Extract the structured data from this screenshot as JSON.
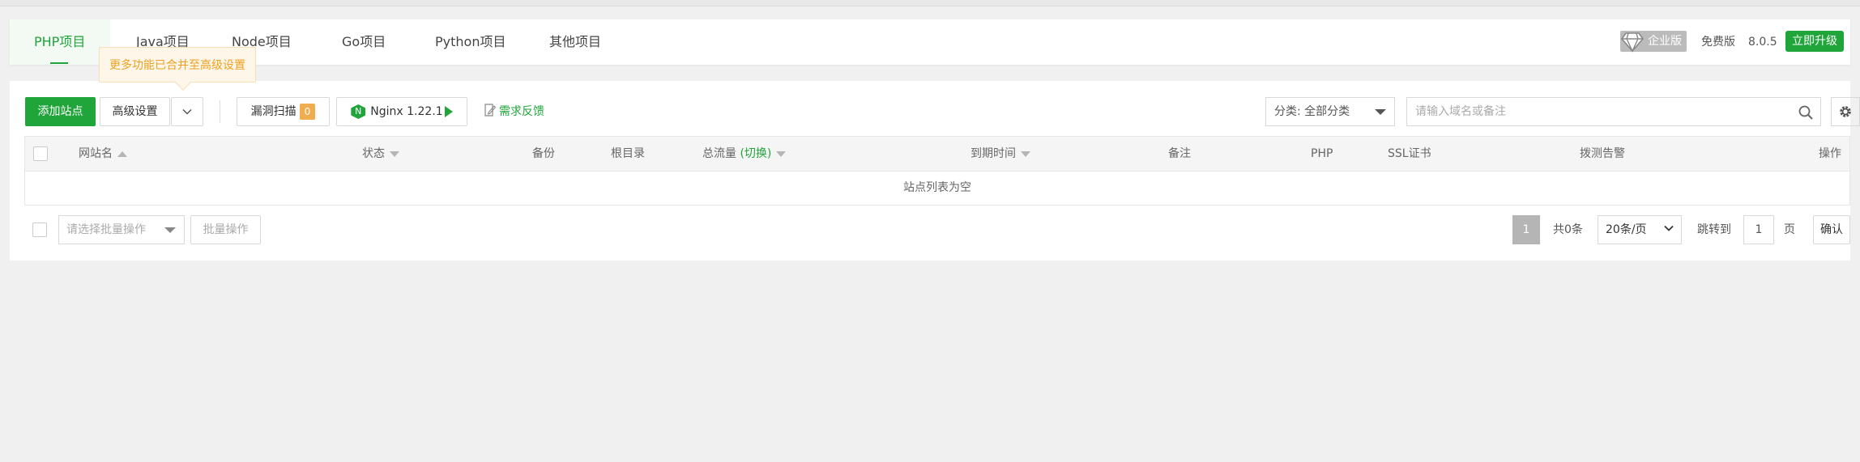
{
  "tabs": [
    {
      "label": "PHP项目",
      "active": true
    },
    {
      "label": "Java项目",
      "active": false
    },
    {
      "label": "Node项目",
      "active": false
    },
    {
      "label": "Go项目",
      "active": false
    },
    {
      "label": "Python项目",
      "active": false
    },
    {
      "label": "其他项目",
      "active": false
    }
  ],
  "header_right": {
    "edition": "企业版",
    "plan": "免费版",
    "version": "8.0.5",
    "upgrade": "立即升级"
  },
  "tooltip": "更多功能已合并至高级设置",
  "toolbar": {
    "add_site": "添加站点",
    "advanced": "高级设置",
    "vuln_scan": "漏洞扫描",
    "vuln_count": "0",
    "nginx": "Nginx 1.22.1",
    "feedback": "需求反馈",
    "category": "分类: 全部分类",
    "search_placeholder": "请输入域名或备注"
  },
  "table": {
    "columns": [
      "网站名",
      "状态",
      "备份",
      "根目录",
      "总流量",
      "(切换)",
      "到期时间",
      "备注",
      "PHP",
      "SSL证书",
      "拨测告警",
      "操作"
    ],
    "empty_text": "站点列表为空"
  },
  "footer": {
    "batch_placeholder": "请选择批量操作",
    "batch_button": "批量操作",
    "current_page": "1",
    "total": "共0条",
    "page_size": "20条/页",
    "jump_label": "跳转到",
    "jump_value": "1",
    "page_unit": "页",
    "confirm": "确认"
  },
  "colors": {
    "accent": "#20a53a",
    "warning": "#f0ad4e"
  }
}
